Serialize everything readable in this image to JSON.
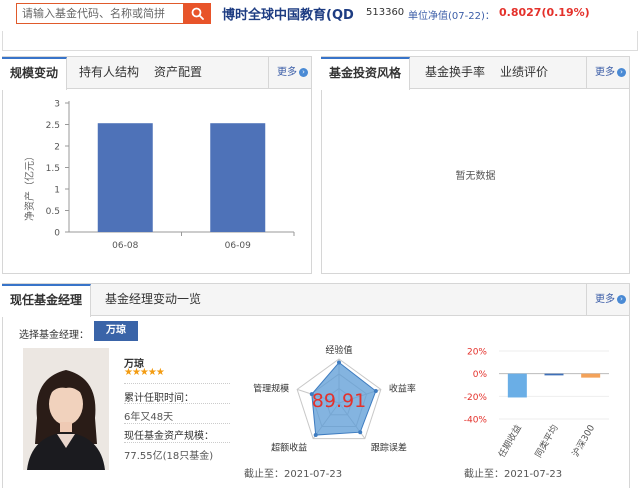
{
  "search": {
    "placeholder": "请输入基金代码、名称或简拼"
  },
  "fund": {
    "name": "博时全球中国教育(QD",
    "code": "513360",
    "nav_label": "单位净值(07-22)：",
    "nav_value": "0.8027(0.19%)"
  },
  "scale_panel": {
    "tabs": [
      "规模变动",
      "持有人结构",
      "资产配置"
    ],
    "more": "更多"
  },
  "style_panel": {
    "tabs": [
      "基金投资风格",
      "基金换手率",
      "业绩评价"
    ],
    "more": "更多",
    "empty_text": "暂无数据"
  },
  "chart_data": {
    "type": "bar",
    "categories": [
      "06-08",
      "06-09"
    ],
    "values": [
      2.53,
      2.53
    ],
    "ylabel": "净资产（亿元）",
    "ylim": [
      0,
      3
    ],
    "yticks": [
      "0",
      "0.5",
      "1",
      "1.5",
      "2",
      "2.5",
      "3"
    ],
    "bar_color": "#4e72b8"
  },
  "manager_panel": {
    "tabs": [
      "现任基金经理",
      "基金经理变动一览"
    ],
    "more": "更多",
    "select_label": "选择基金经理：",
    "selected_manager": "万琼",
    "name": "万琼",
    "stars": "★★★★★",
    "tenure_label": "累计任职时间：",
    "tenure_value": "6年又48天",
    "assets_label": "现任基金资产规模：",
    "assets_value": "77.55亿(18只基金)",
    "deadline_left": "截止至：2021-07-23",
    "deadline_right": "截止至：2021-07-23"
  },
  "radar": {
    "score": "89.91",
    "axes": [
      "经验值",
      "收益率",
      "跟踪误差",
      "超额收益",
      "管理规模"
    ],
    "values": [
      0.92,
      0.88,
      0.82,
      0.9,
      0.65
    ],
    "fill_color": "#5b9bd5"
  },
  "perf_chart": {
    "categories": [
      "任期收益",
      "同类平均",
      "沪深300"
    ],
    "values": [
      -21,
      -1.5,
      -3.5
    ],
    "yticks": [
      "20%",
      "0%",
      "-20%",
      "-40%"
    ],
    "ylim": [
      -40,
      20
    ],
    "colors": [
      "#6aaee6",
      "#3e6fb8",
      "#f3a25a"
    ]
  }
}
